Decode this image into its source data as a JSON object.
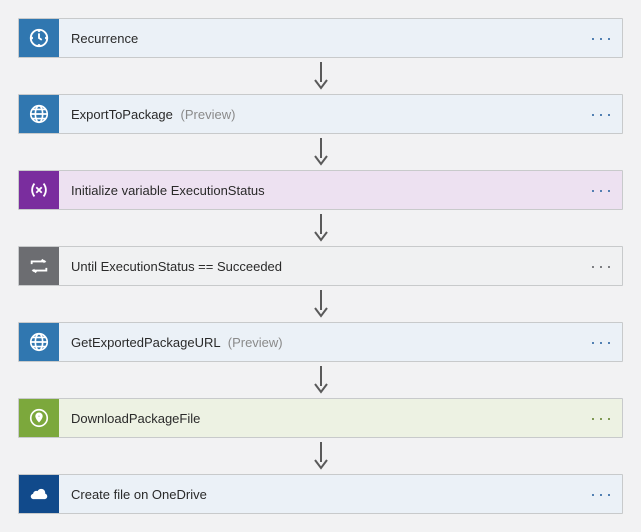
{
  "steps": [
    {
      "label": "Recurrence",
      "preview": "",
      "theme": "blue",
      "icon": "clock"
    },
    {
      "label": "ExportToPackage",
      "preview": "(Preview)",
      "theme": "blue",
      "icon": "globe"
    },
    {
      "label": "Initialize variable ExecutionStatus",
      "preview": "",
      "theme": "purple",
      "icon": "variable"
    },
    {
      "label": "Until ExecutionStatus == Succeeded",
      "preview": "",
      "theme": "gray",
      "icon": "loop"
    },
    {
      "label": "GetExportedPackageURL",
      "preview": "(Preview)",
      "theme": "blue",
      "icon": "globe"
    },
    {
      "label": "DownloadPackageFile",
      "preview": "",
      "theme": "green",
      "icon": "pin"
    },
    {
      "label": "Create file on OneDrive",
      "preview": "",
      "theme": "blue",
      "icon": "onedrive"
    }
  ],
  "menu_glyph": "···"
}
